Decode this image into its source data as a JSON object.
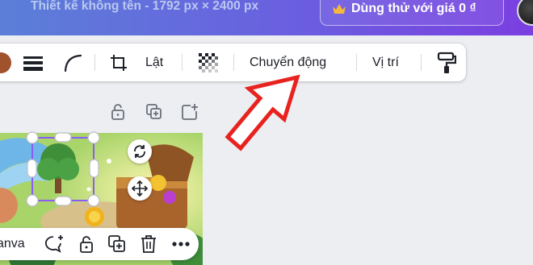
{
  "header": {
    "doc_title": "Thiết kế không tên - 1792 px × 2400 px",
    "trial_button": "Dùng thử với giá 0 ₫"
  },
  "toolbar": {
    "flip_label": "Lật",
    "animate_label": "Chuyển động",
    "position_label": "Vị trí"
  },
  "selection_pill": {
    "canva_label": "anva"
  },
  "colors": {
    "header_gradient_start": "#5b7fd8",
    "header_gradient_end": "#7b3fe0",
    "arrow_red": "#e8231f",
    "selection_purple": "#8b5cf6",
    "fill_color_swatch": "#a0522d"
  },
  "icons": [
    "crown-icon",
    "color-swatch-icon",
    "border-style-icon",
    "corner-rounding-icon",
    "crop-icon",
    "transparency-icon",
    "paint-roller-icon",
    "lock-icon",
    "duplicate-icon",
    "add-page-icon",
    "rotate-icon",
    "move-icon",
    "comment-icon",
    "trash-icon",
    "more-icon"
  ]
}
